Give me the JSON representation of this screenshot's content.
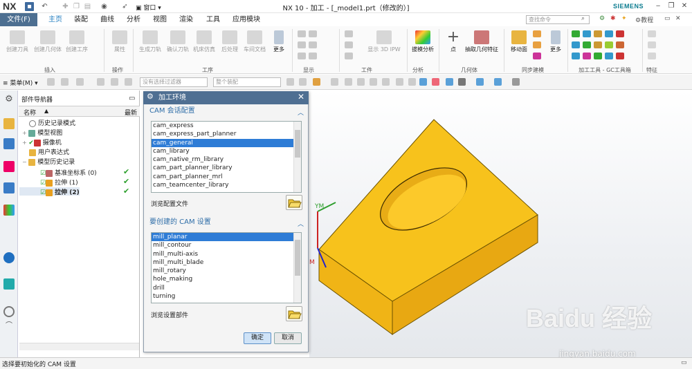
{
  "titlebar": {
    "logo": "NX",
    "window_menu": "窗口",
    "title": "NX 10 - 加工 - [_model1.prt（修改的）]",
    "brand": "SIEMENS"
  },
  "menubar": {
    "file": "文件(F)",
    "tabs": [
      "主页",
      "装配",
      "曲线",
      "分析",
      "视图",
      "渲染",
      "工具",
      "应用模块"
    ],
    "active_tab": "主页",
    "search_placeholder": "查找命令",
    "tutorial": "教程"
  },
  "ribbon": {
    "insert_buttons": [
      "创建刀具",
      "创建几何体",
      "创建工序"
    ],
    "operation_button": "属性",
    "process_buttons": [
      "生成刀轨",
      "确认刀轨",
      "机床仿真",
      "后处理",
      "车间文档"
    ],
    "more": "更多",
    "display_sim_label": "显示 3D IPW",
    "analysis_button": "拔模分析",
    "geometry_buttons": [
      "点",
      "抽取几何特征"
    ],
    "sync_button": "移动面",
    "more2": "更多",
    "groups": [
      "插入",
      "操作",
      "工序",
      "显示",
      "工件",
      "分析",
      "几何体",
      "同步建模",
      "加工工具 - GC工具箱",
      "特征"
    ]
  },
  "toolbar2": {
    "menu": "菜单(M)",
    "filter": "没有选择过滤器",
    "scope": "整个装配"
  },
  "navigator": {
    "title": "部件导航器",
    "col_name": "名称",
    "col_latest": "最新",
    "rows": [
      {
        "label": "历史记录模式"
      },
      {
        "label": "模型视图"
      },
      {
        "label": "摄像机"
      },
      {
        "label": "用户表达式"
      },
      {
        "label": "模型历史记录"
      },
      {
        "label": "基准坐标系 (0)"
      },
      {
        "label": "拉伸 (1)"
      },
      {
        "label": "拉伸 (2)"
      }
    ]
  },
  "dialog": {
    "title": "加工环境",
    "section1": "CAM 会话配置",
    "configs": [
      "cam_express",
      "cam_express_part_planner",
      "cam_general",
      "cam_library",
      "cam_native_rm_library",
      "cam_part_planner_library",
      "cam_part_planner_mrl",
      "cam_teamcenter_library"
    ],
    "selected_config": "cam_general",
    "browse_config": "浏览配置文件",
    "section2": "要创建的 CAM 设置",
    "setups": [
      "mill_planar",
      "mill_contour",
      "mill_multi-axis",
      "mill_multi_blade",
      "mill_rotary",
      "hole_making",
      "drill",
      "turning"
    ],
    "selected_setup": "mill_planar",
    "browse_setup": "浏览设置部件",
    "ok": "确定",
    "cancel": "取消"
  },
  "viewport": {
    "axis_label": "YM",
    "axis_label2": "M"
  },
  "status": "选择要初始化的 CAM 设置",
  "watermark": {
    "logo": "Baidu 经验",
    "url": "jingyan.baidu.com"
  }
}
